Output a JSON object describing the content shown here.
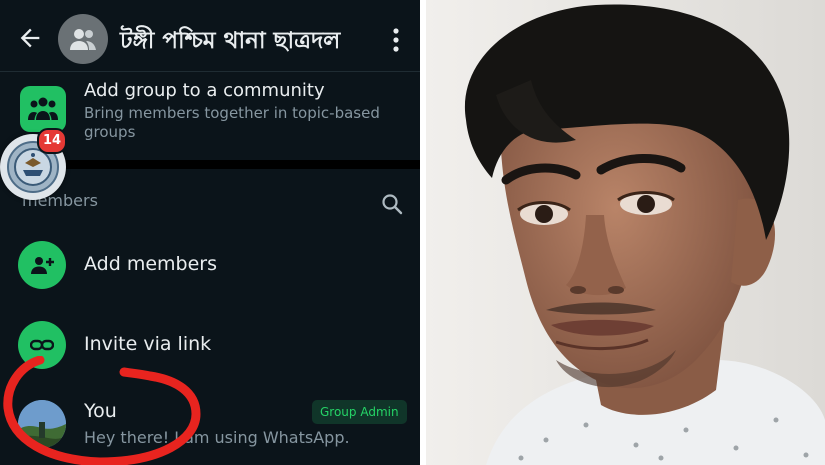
{
  "group_info": {
    "title": "টঙ্গী পশ্চিম থানা ছাত্রদল",
    "community": {
      "title": "Add group to a community",
      "subtitle": "Bring members together in topic-based groups"
    },
    "members_count": "members",
    "actions": [
      {
        "label": "Add members",
        "icon": "person-add-icon"
      },
      {
        "label": "Invite via link",
        "icon": "link-icon"
      }
    ],
    "you": {
      "name": "You",
      "status": "Hey there! I am using WhatsApp.",
      "role": "Group Admin"
    },
    "chat_head_badge": "14"
  },
  "colors": {
    "background": "#0b141a",
    "accent_green": "#21c063",
    "badge_red": "#e53935",
    "annotation_red": "#e8241f"
  },
  "photo": {
    "subject": "young man, front-facing portrait"
  }
}
